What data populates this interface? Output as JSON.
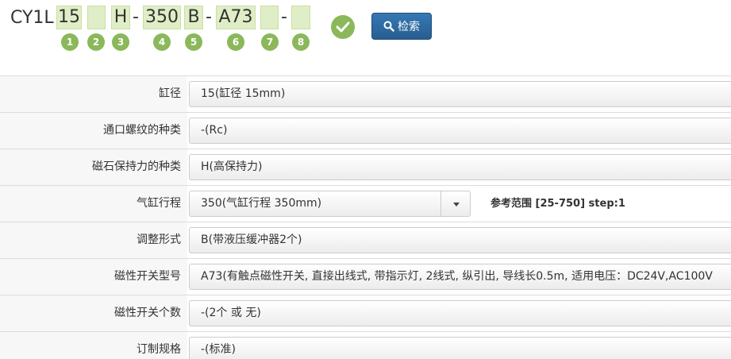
{
  "model_code": {
    "prefix": "CY1L",
    "segments": [
      "15",
      "",
      "H",
      "350",
      "B",
      "A73",
      "",
      ""
    ],
    "dashes": [
      "-",
      "-",
      "-",
      "-"
    ],
    "numbers": [
      "1",
      "2",
      "3",
      "4",
      "5",
      "6",
      "7",
      "8"
    ],
    "accent_color": "#8bb85a",
    "segment_bg": "#dfeec6"
  },
  "toolbar": {
    "search_label": "检索",
    "search_color": "#285e8f"
  },
  "rows": [
    {
      "label": "缸径",
      "value": "15(缸径 15mm)"
    },
    {
      "label": "通口螺纹的种类",
      "value": "-(Rc)"
    },
    {
      "label": "磁石保持力的种类",
      "value": "H(高保持力)"
    },
    {
      "label": "气缸行程",
      "value": "350(气缸行程 350mm)",
      "hint": "参考范围 [25-750] step:1"
    },
    {
      "label": "调整形式",
      "value": "B(带液压缓冲器2个)"
    },
    {
      "label": "磁性开关型号",
      "value": "A73(有触点磁性开关, 直接出线式, 带指示灯, 2线式, 纵引出, 导线长0.5m, 适用电压：DC24V,AC100V"
    },
    {
      "label": "磁性开关个数",
      "value": "-(2个 或 无)"
    },
    {
      "label": "订制规格",
      "value": "-(标准)"
    }
  ]
}
